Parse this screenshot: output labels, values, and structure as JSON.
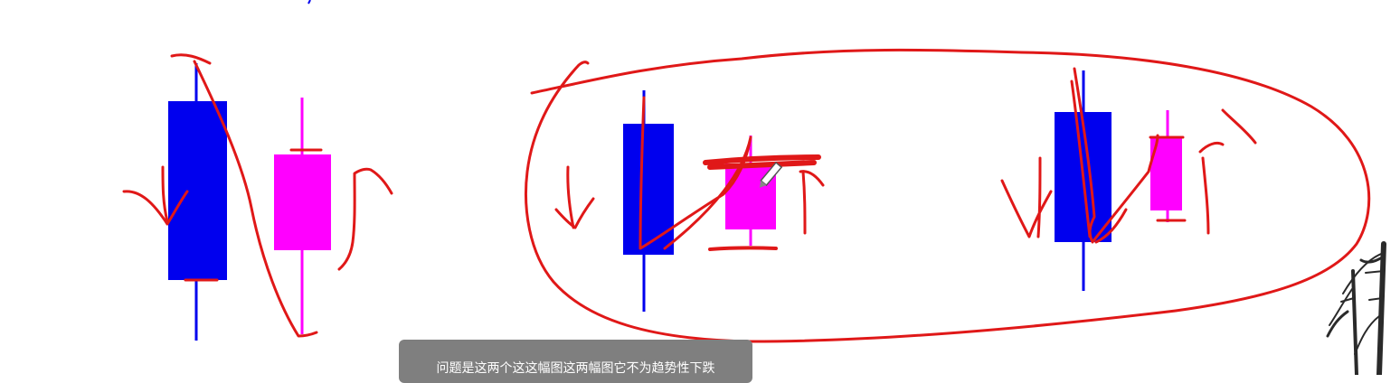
{
  "colors": {
    "bearish_candle": "#0000ee",
    "bullish_candle": "#ff00ff",
    "annotation_ink": "#e01818",
    "subtitle_bg": "#7f7f7f",
    "bamboo": "#2a2a2a"
  },
  "icons": {
    "cursor": "pen-cursor-icon",
    "decoration": "bamboo-icon"
  },
  "subtitle": {
    "text": "问题是这两个这这幅图这两幅图它不为趋势性下跌"
  }
}
